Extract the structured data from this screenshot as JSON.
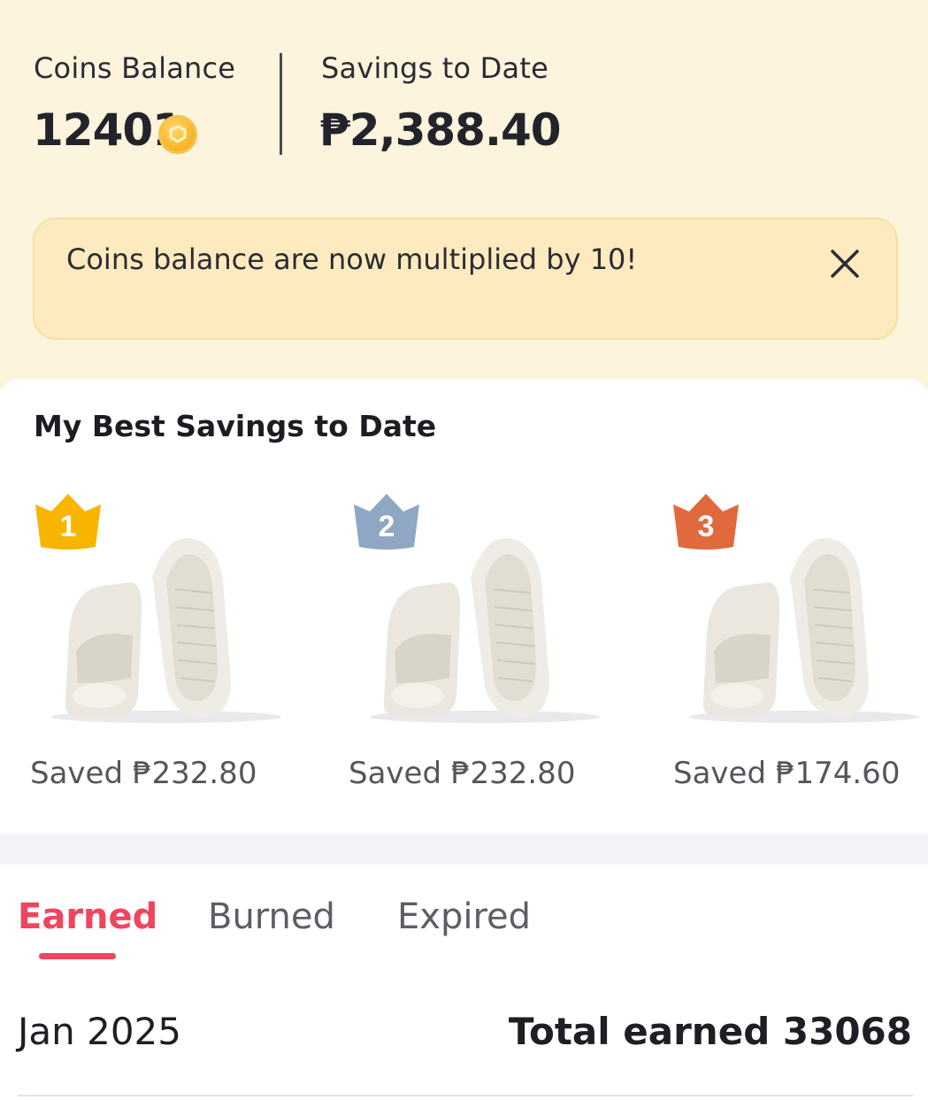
{
  "header": {
    "coins_label": "Coins Balance",
    "coins_value": "12401",
    "savings_label": "Savings to Date",
    "savings_value": "₱2,388.40"
  },
  "notice": {
    "text": "Coins balance are now multiplied by 10!"
  },
  "best_savings": {
    "title": "My Best Savings to Date",
    "items": [
      {
        "rank": "1",
        "saved": "Saved ₱232.80",
        "crown_color": "#f7b500"
      },
      {
        "rank": "2",
        "saved": "Saved ₱232.80",
        "crown_color": "#8fa6c4"
      },
      {
        "rank": "3",
        "saved": "Saved ₱174.60",
        "crown_color": "#e06a3e"
      }
    ]
  },
  "tabs": [
    {
      "label": "Earned",
      "active": true
    },
    {
      "label": "Burned",
      "active": false
    },
    {
      "label": "Expired",
      "active": false
    }
  ],
  "summary": {
    "month": "Jan 2025",
    "total": "Total earned 33068"
  },
  "colors": {
    "accent": "#f0455e",
    "top_bg": "#fdf4de",
    "notice_bg": "#fdebbf"
  }
}
